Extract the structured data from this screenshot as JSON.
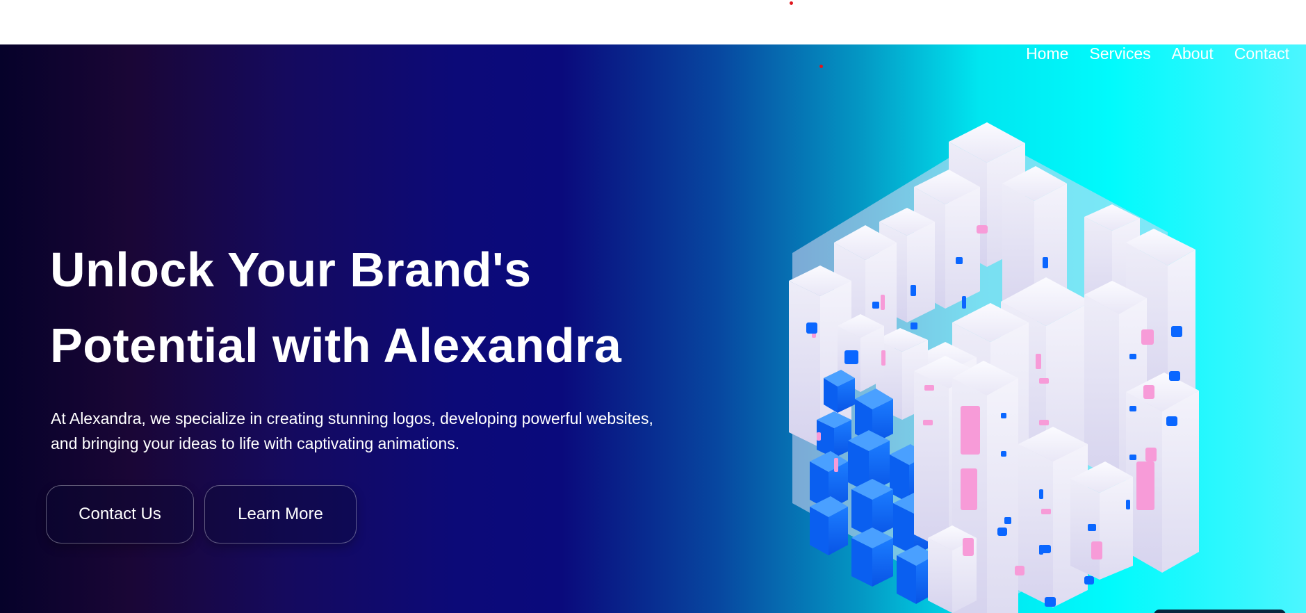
{
  "nav": {
    "items": [
      {
        "label": "Home"
      },
      {
        "label": "Services"
      },
      {
        "label": "About"
      },
      {
        "label": "Contact"
      }
    ]
  },
  "hero": {
    "headline_line1": "Unlock Your Brand's",
    "headline_line2": "Potential with Alexandra",
    "lead_line1": "At Alexandra, we specialize in creating stunning logos, developing powerful websites,",
    "lead_line2": "and bringing your ideas to life with captivating animations.",
    "primary_button": "Contact Us",
    "secondary_button": "Learn More"
  },
  "colors": {
    "gradient_start": "#06022a",
    "gradient_mid": "#0a0a7c",
    "gradient_end": "#00fafc",
    "cube_white": "#ecebf7",
    "cube_blue": "#0a66ff",
    "cube_pink": "#f79bd8",
    "accent_dot": "#e0161d"
  },
  "icons": {
    "hero_art": "isometric-cube-cluster-illustration"
  }
}
